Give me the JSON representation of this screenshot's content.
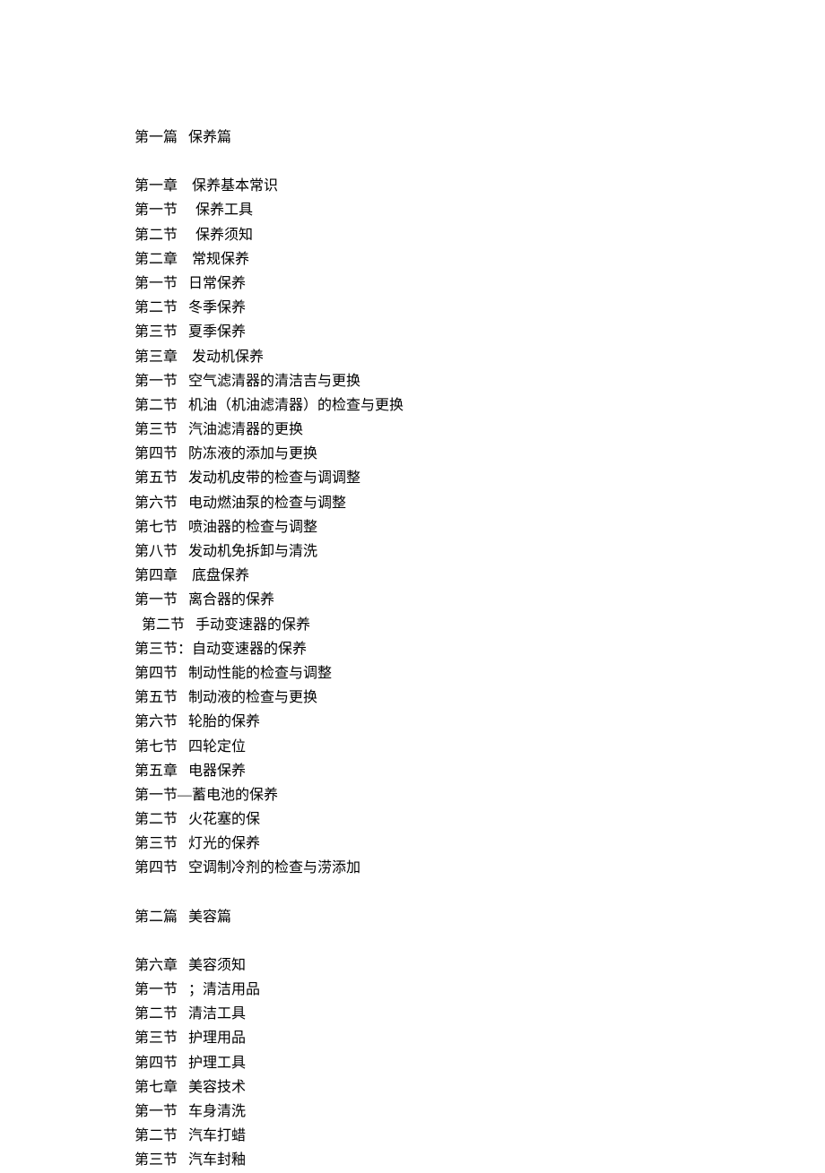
{
  "toc": {
    "part1": {
      "header": "第一篇   保养篇",
      "chapters": [
        {
          "title": "第一章    保养基本常识",
          "sections": [
            "第一节     保养工具",
            "第二节     保养须知"
          ]
        },
        {
          "title": "第二章    常规保养",
          "sections": [
            "第一节   日常保养",
            "第二节   冬季保养",
            "第三节   夏季保养"
          ]
        },
        {
          "title": "第三章    发动机保养",
          "sections": [
            "第一节   空气滤清器的清洁吉与更换",
            "第二节   机油（机油滤清器）的检查与更换",
            "第三节   汽油滤清器的更换",
            "第四节   防冻液的添加与更换",
            "第五节   发动机皮带的检查与调调整",
            "第六节   电动燃油泵的检查与调整",
            "第七节   喷油器的检查与调整",
            "第八节   发动机免拆卸与清洗"
          ]
        },
        {
          "title": "第四章    底盘保养",
          "sections": [
            "第一节   离合器的保养",
            "  第二节   手动变速器的保养",
            "第三节：自动变速器的保养",
            "第四节   制动性能的检查与调整",
            "第五节   制动液的检查与更换",
            "第六节   轮胎的保养",
            "第七节   四轮定位"
          ]
        },
        {
          "title": "第五章   电器保养",
          "sections": [
            "第一节—蓄电池的保养",
            "第二节   火花塞的保",
            "第三节   灯光的保养",
            "第四节   空调制冷剂的检查与涝添加"
          ]
        }
      ]
    },
    "part2": {
      "header": "第二篇   美容篇",
      "chapters": [
        {
          "title": "第六章   美容须知",
          "sections": [
            "第一节   ；清洁用品",
            "第二节   清洁工具",
            "第三节   护理用品",
            "第四节   护理工具"
          ]
        },
        {
          "title": "第七章   美容技术",
          "sections": [
            "第一节   车身清洗",
            "第二节   汽车打蜡",
            "第三节   汽车封釉"
          ]
        }
      ]
    }
  }
}
